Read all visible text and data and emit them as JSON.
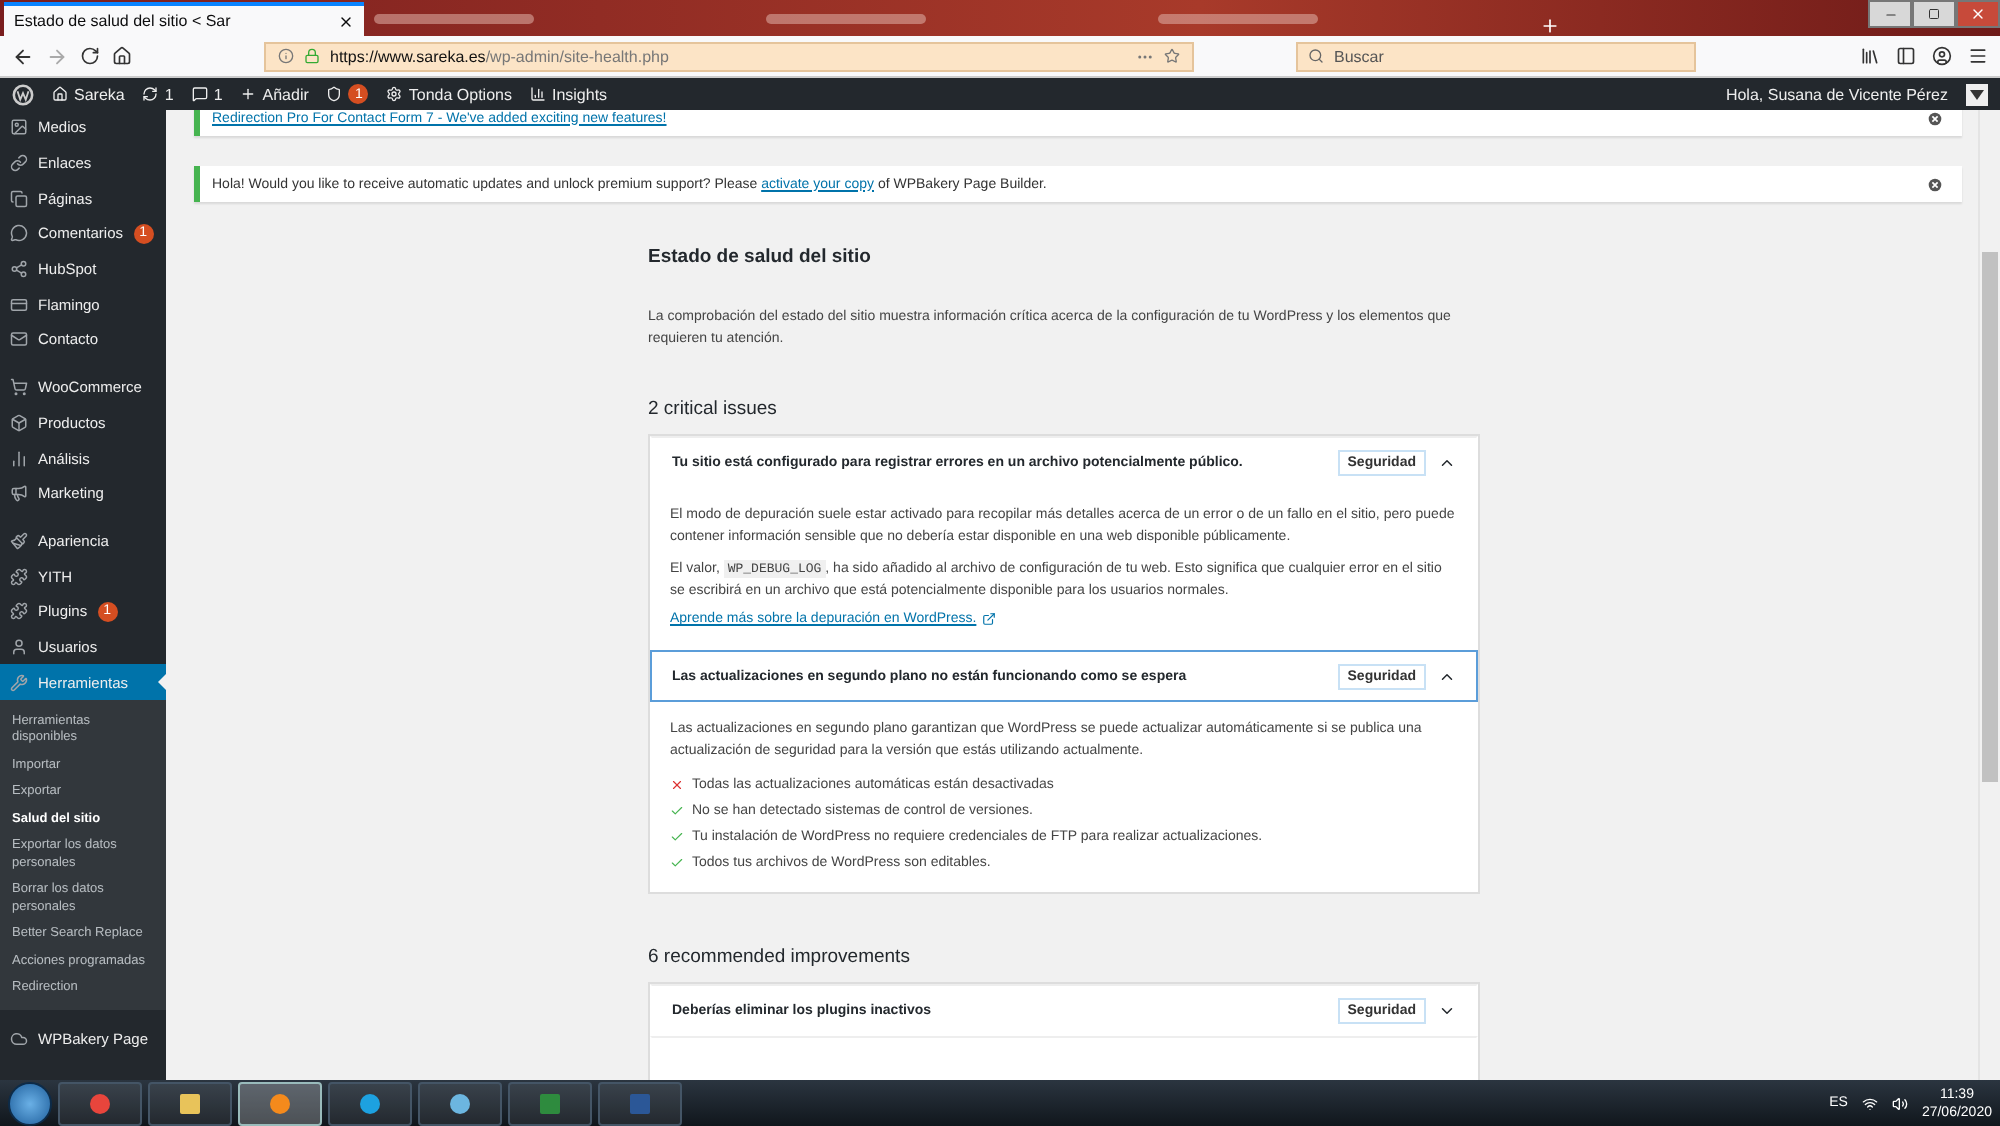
{
  "browser": {
    "tabs": [
      {
        "title": "Estado de salud del sitio < Sar",
        "selected": true
      },
      {
        "selected": false
      },
      {
        "selected": false
      },
      {
        "selected": false
      }
    ],
    "url_host": "https://www.sareka.es",
    "url_path": "/wp-admin/site-health.php",
    "search": {
      "placeholder": "Buscar"
    }
  },
  "admin_bar": {
    "site": "Sareka",
    "updates": "1",
    "comments": "1",
    "new": "Añadir",
    "seo_badge": "1",
    "theme_options": "Tonda Options",
    "insights": "Insights",
    "greeting": "Hola, Susana de Vicente Pérez"
  },
  "sidebar": {
    "groups": [
      {
        "items": [
          {
            "label": "Medios",
            "selected": false
          },
          {
            "label": "Enlaces",
            "selected": false
          },
          {
            "label": "Páginas",
            "selected": false
          },
          {
            "label": "Comentarios",
            "badge": "1",
            "selected": false
          },
          {
            "label": "HubSpot",
            "selected": false
          },
          {
            "label": "Flamingo",
            "selected": false
          },
          {
            "label": "Contacto",
            "selected": false
          }
        ]
      },
      {
        "items": [
          {
            "label": "WooCommerce",
            "selected": false
          },
          {
            "label": "Productos",
            "selected": false
          },
          {
            "label": "Análisis",
            "selected": false
          },
          {
            "label": "Marketing",
            "selected": false
          }
        ]
      },
      {
        "items": [
          {
            "label": "Apariencia",
            "selected": false
          },
          {
            "label": "YITH",
            "selected": false
          },
          {
            "label": "Plugins",
            "badge": "1",
            "selected": false
          },
          {
            "label": "Usuarios",
            "selected": false
          },
          {
            "label": "Herramientas",
            "selected": true,
            "submenu": [
              {
                "label": "Herramientas disponibles",
                "selected": false
              },
              {
                "label": "Importar",
                "selected": false
              },
              {
                "label": "Exportar",
                "selected": false
              },
              {
                "label": "Salud del sitio",
                "selected": true
              },
              {
                "label": "Exportar los datos personales",
                "selected": false
              },
              {
                "label": "Borrar los datos personales",
                "selected": false
              },
              {
                "label": "Better Search Replace",
                "selected": false
              },
              {
                "label": "Acciones programadas",
                "selected": false
              },
              {
                "label": "Redirection",
                "selected": false
              }
            ]
          }
        ]
      },
      {
        "items": [
          {
            "label": "WPBakery Page",
            "selected": false
          }
        ]
      }
    ]
  },
  "notices": [
    {
      "link": "Redirection Pro For Contact Form 7 - We've added exciting new features!"
    },
    {
      "before": "Hola! Would you like to receive automatic updates and unlock premium support? Please ",
      "link": "activate your copy",
      "after": " of WPBakery Page Builder."
    }
  ],
  "page": {
    "title": "Estado de salud del sitio",
    "description": "La comprobación del estado del sitio muestra información crítica acerca de la configuración de tu WordPress y los elementos que requieren tu atención.",
    "critical_heading": "2 critical issues",
    "critical": [
      {
        "title": "Tu sitio está configurado para registrar errores en un archivo potencialmente público.",
        "tag": "Seguridad",
        "expanded": true,
        "focused": false,
        "paragraphs": [
          {
            "before": "El modo de depuración suele estar activado para recopilar más detalles acerca de un error o de un fallo en el sitio, pero puede contener información sensible que no debería estar disponible en una web disponible públicamente."
          },
          {
            "before": "El valor, ",
            "code": "WP_DEBUG_LOG",
            "after": ", ha sido añadido al archivo de configuración de tu web. Esto significa que cualquier error en el sitio se escribirá en un archivo que está potencialmente disponible para los usuarios normales."
          }
        ],
        "link": "Aprende más sobre la depuración en WordPress."
      },
      {
        "title": "Las actualizaciones en segundo plano no están funcionando como se espera",
        "tag": "Seguridad",
        "expanded": true,
        "focused": true,
        "paragraphs": [
          {
            "before": "Las actualizaciones en segundo plano garantizan que WordPress se puede actualizar automáticamente si se publica una actualización de seguridad para la versión que estás utilizando actualmente."
          }
        ],
        "checks": [
          {
            "text": "Todas las actualizaciones automáticas están desactivadas",
            "passed": false
          },
          {
            "text": "No se han detectado sistemas de control de versiones.",
            "passed": true
          },
          {
            "text": "Tu instalación de WordPress no requiere credenciales de FTP para realizar actualizaciones.",
            "passed": true
          },
          {
            "text": "Todos tus archivos de WordPress son editables.",
            "passed": true
          }
        ]
      }
    ],
    "recommended_heading": "6 recommended improvements",
    "recommended": [
      {
        "title": "Deberías eliminar los plugins inactivos",
        "tag": "Seguridad",
        "expanded": false,
        "focused": false
      }
    ]
  },
  "taskbar": {
    "apps": [
      {
        "selected": false
      },
      {
        "selected": false
      },
      {
        "selected": true
      },
      {
        "selected": false
      },
      {
        "selected": false
      },
      {
        "selected": false
      },
      {
        "selected": false
      }
    ],
    "language": "ES",
    "time": "11:39",
    "date": "27/06/2020"
  }
}
